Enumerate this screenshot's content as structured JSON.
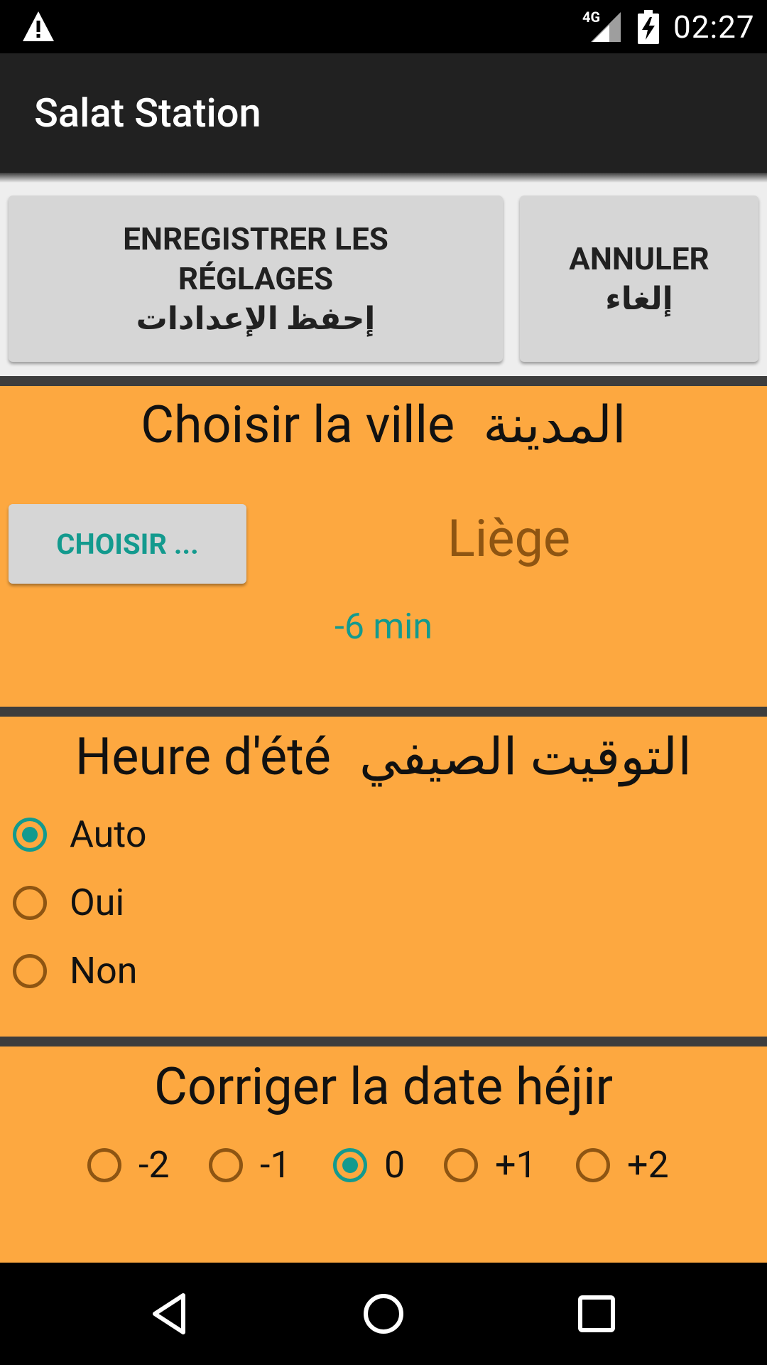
{
  "status_bar": {
    "time": "02:27",
    "network": "4G",
    "icons": [
      "warning-icon",
      "signal-icon",
      "battery-charging-icon"
    ]
  },
  "app_bar": {
    "title": "Salat Station"
  },
  "actions": {
    "save_fr": "ENREGISTRER LES RÉGLAGES",
    "save_ar": "إحفظ الإعدادات",
    "cancel_fr": "ANNULER",
    "cancel_ar": "إلغاء"
  },
  "city_section": {
    "title_fr": "Choisir la ville",
    "title_ar": "المدينة",
    "choose_button": "CHOISIR ...",
    "city": "Liège",
    "offset": "-6 min"
  },
  "dst_section": {
    "title_fr": "Heure d'été",
    "title_ar": "التوقيت الصيفي",
    "options": [
      "Auto",
      "Oui",
      "Non"
    ],
    "selected": "Auto"
  },
  "hijri_section": {
    "title": "Corriger la date héjir",
    "options": [
      "-2",
      "-1",
      "0",
      "+1",
      "+2"
    ],
    "selected": "0"
  },
  "colors": {
    "section_bg": "#FDA840",
    "accent": "#139A8E",
    "city_text": "#8E5512",
    "separator": "#3D3D3D"
  },
  "nav_bar": {
    "icons": [
      "back-icon",
      "home-icon",
      "recents-icon"
    ]
  }
}
